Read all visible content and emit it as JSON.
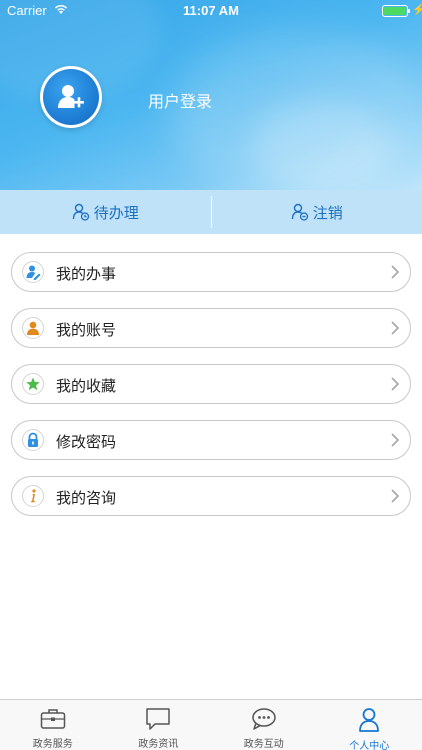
{
  "status_bar": {
    "carrier": "Carrier",
    "time": "11:07 AM",
    "bolt": "⚡"
  },
  "header": {
    "login_label": "用户登录",
    "avatar_icon": "add-user-icon"
  },
  "action_bar": {
    "pending_label": "待办理",
    "logout_label": "注销"
  },
  "menu": {
    "items": [
      {
        "label": "我的办事",
        "icon": "person-edit-icon",
        "icon_color": "#2f8fe0"
      },
      {
        "label": "我的账号",
        "icon": "person-icon",
        "icon_color": "#e08a1e"
      },
      {
        "label": "我的收藏",
        "icon": "star-icon",
        "icon_color": "#4dbb4a"
      },
      {
        "label": "修改密码",
        "icon": "lock-icon",
        "icon_color": "#2f8fe0"
      },
      {
        "label": "我的咨询",
        "icon": "info-icon",
        "icon_color": "#e08a1e"
      }
    ]
  },
  "tabbar": {
    "tabs": [
      {
        "label": "政务服务",
        "icon": "briefcase-icon"
      },
      {
        "label": "政务资讯",
        "icon": "chat-bubble-icon"
      },
      {
        "label": "政务互动",
        "icon": "chat-dots-icon"
      },
      {
        "label": "个人中心",
        "icon": "person-outline-icon"
      }
    ],
    "active_index": 3,
    "active_color": "#1677d2"
  }
}
